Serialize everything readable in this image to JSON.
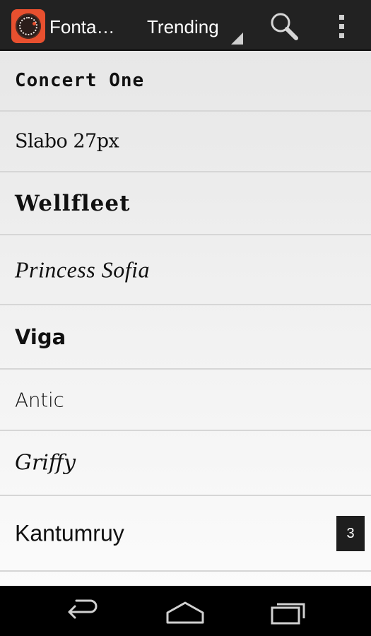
{
  "app": {
    "title": "Fonta…",
    "icon": "fontaholic-dial-icon"
  },
  "action_bar": {
    "spinner_label": "Trending",
    "search_icon": "search-icon",
    "overflow_icon": "overflow-menu-icon"
  },
  "fonts": [
    {
      "name": "Concert One"
    },
    {
      "name": "Slabo 27px"
    },
    {
      "name": "Wellfleet"
    },
    {
      "name": "Princess Sofia"
    },
    {
      "name": "Viga"
    },
    {
      "name": "Antic"
    },
    {
      "name": "Griffy"
    },
    {
      "name": "Kantumruy",
      "badge": "3"
    }
  ],
  "nav": {
    "back_icon": "back-icon",
    "home_icon": "home-icon",
    "recents_icon": "recent-apps-icon"
  },
  "colors": {
    "action_bar_bg": "#222222",
    "app_icon_accent": "#e8502f",
    "list_bg": "#ececec",
    "badge_bg": "#1e1e1e",
    "nav_bg": "#000000"
  }
}
